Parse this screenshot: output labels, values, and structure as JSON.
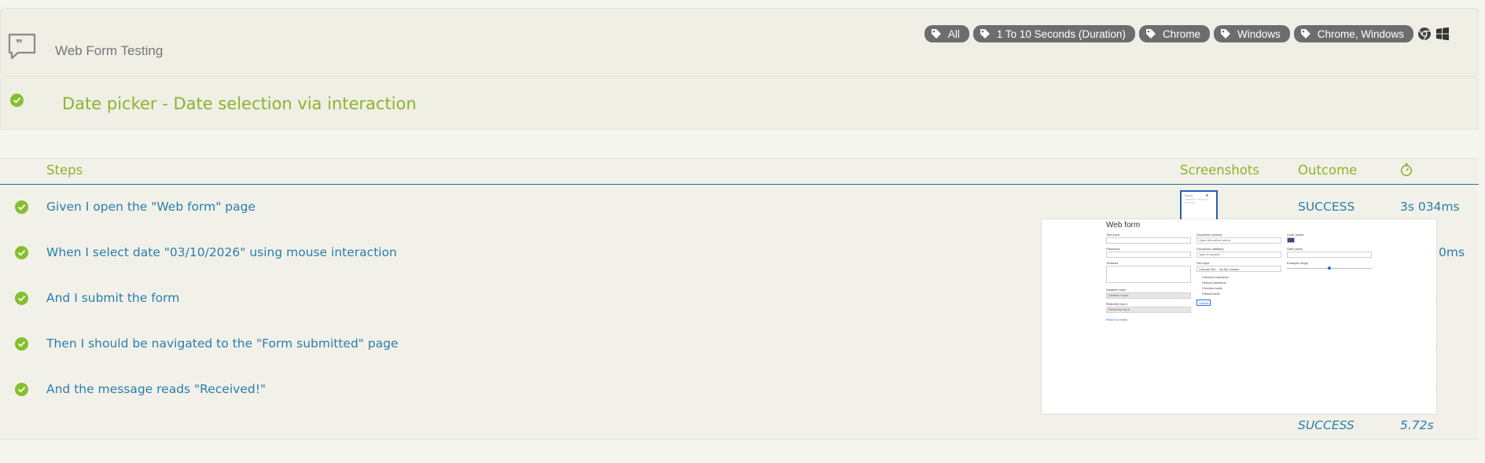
{
  "feature": {
    "title": "Web Form Testing",
    "icon": "quote-bubble-icon"
  },
  "tags": [
    {
      "label": "All",
      "icon": "tag-icon"
    },
    {
      "label": "1 To 10 Seconds (Duration)",
      "icon": "tag-icon"
    },
    {
      "label": "Chrome",
      "icon": "tag-icon"
    },
    {
      "label": "Windows",
      "icon": "tag-icon"
    },
    {
      "label": "Chrome, Windows",
      "icon": "tag-icon"
    }
  ],
  "environment_icons": [
    "chrome-icon",
    "windows-icon"
  ],
  "scenario": {
    "title": "Date picker - Date selection via interaction",
    "status_icon": "success-check-icon"
  },
  "table": {
    "headers": {
      "steps": "Steps",
      "screenshots": "Screenshots",
      "outcome": "Outcome",
      "duration_icon": "stopwatch-icon"
    },
    "rows": [
      {
        "step": "Given I open the \"Web form\" page",
        "outcome": "SUCCESS",
        "duration": "3s 034ms"
      },
      {
        "step": "When I select date \"03/10/2026\" using mouse interaction",
        "outcome": "",
        "duration": "0ms"
      },
      {
        "step": "And I submit the form",
        "outcome": "",
        "duration": "s"
      },
      {
        "step": "Then I should be navigated to the \"Form submitted\" page",
        "outcome": "",
        "duration": "s"
      },
      {
        "step": "And the message reads \"Received!\"",
        "outcome": "",
        "duration": "s"
      }
    ],
    "total": {
      "outcome": "SUCCESS",
      "duration": "5.72s"
    }
  },
  "preview": {
    "title": "Web form",
    "labels": {
      "text_input": "Text input",
      "password": "Password",
      "textarea": "Textarea",
      "disabled_input": "Disabled input",
      "disabled_placeholder": "Disabled input",
      "readonly_input": "Readonly input",
      "readonly_value": "Readonly input",
      "return": "Return to index",
      "dropdown_select": "Dropdown (select)",
      "dropdown_select_value": "Open this select menu",
      "dropdown_datalist": "Dropdown (datalist)",
      "dropdown_datalist_placeholder": "Type to search...",
      "file_input": "File input",
      "file_button": "Choose File",
      "file_none": "No file chosen",
      "checked_checkbox": "Checked checkbox",
      "default_checkbox": "Default checkbox",
      "checked_radio": "Checked radio",
      "default_radio": "Default radio",
      "submit": "Submit",
      "color_picker": "Color picker",
      "date_picker": "Date picker",
      "example_range": "Example range"
    },
    "color_value": "#563d7c"
  }
}
